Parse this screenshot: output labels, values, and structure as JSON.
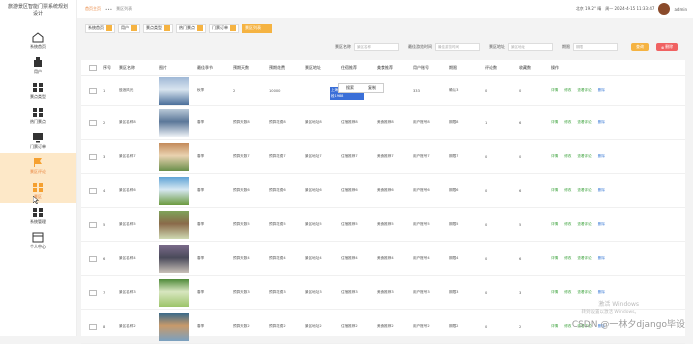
{
  "brand": {
    "title": "旅游景区智能门票系统规划设计"
  },
  "sidebar": {
    "items": [
      {
        "label": "系统首页",
        "icon": "home-icon",
        "active": false
      },
      {
        "label": "用户",
        "icon": "user-icon",
        "active": false
      },
      {
        "label": "景点类型",
        "icon": "grid-icon",
        "active": false
      },
      {
        "label": "热门景点",
        "icon": "grid-icon",
        "active": false
      },
      {
        "label": "门票订单",
        "icon": "monitor-icon",
        "active": false
      },
      {
        "label": "景区评论",
        "icon": "flag-icon",
        "active": true
      },
      {
        "label": "景区",
        "icon": "grid-icon",
        "active": true
      },
      {
        "label": "系统管理",
        "icon": "grid-icon",
        "active": false
      },
      {
        "label": "个人中心",
        "icon": "card-icon",
        "active": false
      }
    ]
  },
  "topbar": {
    "crumb_home": "首页主页",
    "crumb_sep": "•••",
    "crumb_current": "景区列表",
    "weather": "北京 19.2° 晴",
    "date": "周一 2024-4-15 11:33:47",
    "username": "admin"
  },
  "tags": [
    {
      "label": "系统首页",
      "active": false
    },
    {
      "label": "用户",
      "active": false
    },
    {
      "label": "景点类型",
      "active": false
    },
    {
      "label": "热门景点",
      "active": false
    },
    {
      "label": "门票订单",
      "active": false
    },
    {
      "label": "景区列表",
      "active": true
    }
  ],
  "filters": {
    "f1_label": "景区名称",
    "f1_placeholder": "景区名称",
    "f2_label": "最佳游览时间",
    "f2_placeholder": "最佳游览时间",
    "f3_label": "景区地址",
    "f3_placeholder": "景区地址",
    "f4_label": "期限",
    "f4_placeholder": "期限",
    "search": "查询",
    "delete": "删除"
  },
  "table": {
    "headers": [
      "序号",
      "景区名称",
      "图片",
      "最佳季节",
      "预期天数",
      "预期花费",
      "景区地址",
      "住宿推荐",
      "美食推荐",
      "用户账号",
      "期限",
      "评论数",
      "收藏数",
      "操作"
    ],
    "rows": [
      {
        "idx": "1",
        "name": "鼓浪风光",
        "season": "秋季",
        "days": "2",
        "cost": "10000",
        "addr": "上海市浦东新区路一段1988",
        "hotel": "33",
        "food": "33",
        "account": "333",
        "limit": "确认3",
        "comments": "0",
        "fav": "0"
      },
      {
        "idx": "2",
        "name": "景区名称8",
        "season": "春季",
        "days": "预算天数8",
        "cost": "预算花费8",
        "addr": "景区地址8",
        "hotel": "住宿推荐8",
        "food": "美食推荐8",
        "account": "用户账号8",
        "limit": "期限8",
        "comments": "1",
        "fav": "6"
      },
      {
        "idx": "3",
        "name": "景区名称7",
        "season": "春季",
        "days": "预算天数7",
        "cost": "预算花费7",
        "addr": "景区地址7",
        "hotel": "住宿推荐7",
        "food": "美食推荐7",
        "account": "用户账号7",
        "limit": "期限7",
        "comments": "0",
        "fav": "0"
      },
      {
        "idx": "4",
        "name": "景区名称6",
        "season": "春季",
        "days": "预算天数6",
        "cost": "预算花费6",
        "addr": "景区地址6",
        "hotel": "住宿推荐6",
        "food": "美食推荐6",
        "account": "用户账号6",
        "limit": "期限6",
        "comments": "0",
        "fav": "6"
      },
      {
        "idx": "5",
        "name": "景区名称5",
        "season": "春季",
        "days": "预算天数5",
        "cost": "预算花费5",
        "addr": "景区地址5",
        "hotel": "住宿推荐5",
        "food": "美食推荐5",
        "account": "用户账号5",
        "limit": "期限5",
        "comments": "0",
        "fav": "5"
      },
      {
        "idx": "6",
        "name": "景区名称4",
        "season": "春季",
        "days": "预算天数4",
        "cost": "预算花费4",
        "addr": "景区地址4",
        "hotel": "住宿推荐4",
        "food": "美食推荐4",
        "account": "用户账号4",
        "limit": "期限4",
        "comments": "0",
        "fav": "6"
      },
      {
        "idx": "7",
        "name": "景区名称3",
        "season": "春季",
        "days": "预算天数3",
        "cost": "预算花费3",
        "addr": "景区地址3",
        "hotel": "住宿推荐3",
        "food": "美食推荐3",
        "account": "用户账号3",
        "limit": "期限3",
        "comments": "0",
        "fav": "3"
      },
      {
        "idx": "8",
        "name": "景区名称2",
        "season": "春季",
        "days": "预算天数2",
        "cost": "预算花费2",
        "addr": "景区地址2",
        "hotel": "住宿推荐2",
        "food": "美食推荐2",
        "account": "用户账号2",
        "limit": "期限2",
        "comments": "0",
        "fav": "2"
      }
    ],
    "actions": [
      "详情",
      "修改",
      "查看评论",
      "删除"
    ]
  },
  "popup": {
    "search": "搜索",
    "copy": "复制"
  },
  "watermark": {
    "win1": "激活 Windows",
    "win2": "转到设置以激活 Windows。",
    "csdn": "CSDN @一林夕django毕设"
  },
  "colors": {
    "accent": "#f5b342",
    "danger": "#f06262",
    "link": "#3b7bd6",
    "green": "#3da33d"
  }
}
